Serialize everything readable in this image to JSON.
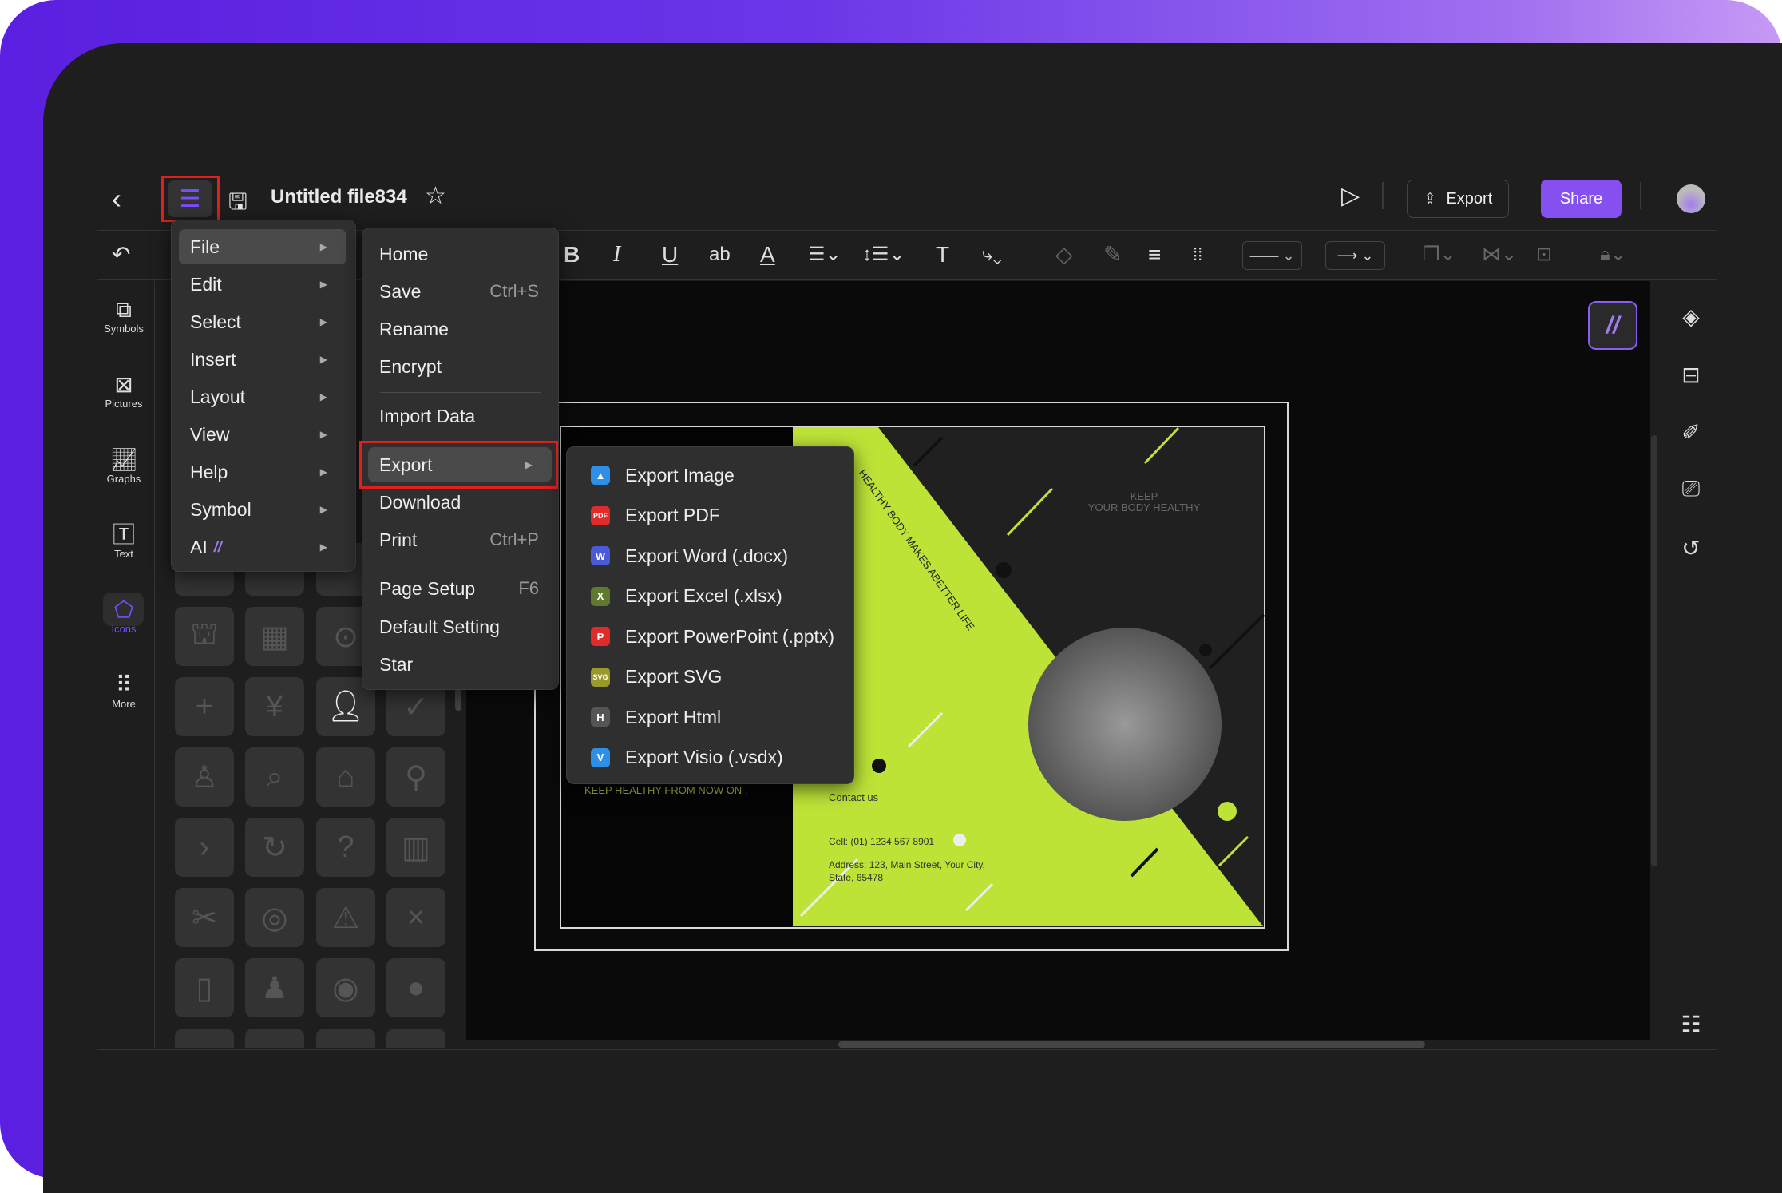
{
  "header": {
    "title": "Untitled file834",
    "export_label": "Export",
    "share_label": "Share"
  },
  "colors": {
    "accent": "#7c4dff",
    "share_bg": "#8550ef",
    "lime": "#bde337",
    "highlight_border": "#e0201c"
  },
  "sidebar": {
    "items": [
      {
        "label": "Symbols",
        "icon": "symbols-icon"
      },
      {
        "label": "Pictures",
        "icon": "pictures-icon"
      },
      {
        "label": "Graphs",
        "icon": "graphs-icon"
      },
      {
        "label": "Text",
        "icon": "text-icon"
      },
      {
        "label": "Icons",
        "icon": "icons-icon",
        "active": true
      },
      {
        "label": "More",
        "icon": "more-icon"
      }
    ]
  },
  "main_menu": {
    "items": [
      {
        "label": "File"
      },
      {
        "label": "Edit"
      },
      {
        "label": "Select"
      },
      {
        "label": "Insert"
      },
      {
        "label": "Layout"
      },
      {
        "label": "View"
      },
      {
        "label": "Help"
      },
      {
        "label": "Symbol"
      },
      {
        "label": "AI"
      }
    ]
  },
  "file_menu": {
    "items": [
      {
        "label": "Home"
      },
      {
        "label": "Save",
        "shortcut": "Ctrl+S"
      },
      {
        "label": "Rename"
      },
      {
        "label": "Encrypt"
      },
      {
        "label": "Import Data"
      },
      {
        "label": "Export"
      },
      {
        "label": "Download"
      },
      {
        "label": "Print",
        "shortcut": "Ctrl+P"
      },
      {
        "label": "Page Setup",
        "shortcut": "F6"
      },
      {
        "label": "Default Setting"
      },
      {
        "label": "Star"
      }
    ]
  },
  "export_menu": {
    "items": [
      {
        "label": "Export Image",
        "badge": "",
        "color": "#2e8fe6"
      },
      {
        "label": "Export PDF",
        "badge": "PDF",
        "color": "#e02b2b"
      },
      {
        "label": "Export Word (.docx)",
        "badge": "W",
        "color": "#4a5ad8"
      },
      {
        "label": "Export Excel (.xlsx)",
        "badge": "X",
        "color": "#5f7a2e"
      },
      {
        "label": "Export PowerPoint (.pptx)",
        "badge": "P",
        "color": "#e02b2b"
      },
      {
        "label": "Export SVG",
        "badge": "SVG",
        "color": "#9a9a2a"
      },
      {
        "label": "Export Html",
        "badge": "H",
        "color": "#555555"
      },
      {
        "label": "Export Visio (.vsdx)",
        "badge": "V",
        "color": "#2e8fe6"
      }
    ]
  },
  "document": {
    "slogan": "HEALTHY BODY MAKES ABETTER LIFE",
    "keep": "KEEP",
    "your_body": "YOUR BODY HEALTHY",
    "keep_healthy": "KEEP HEALTHY FROM NOW ON .",
    "contact": "Contact us",
    "cell": "Cell: (01) 1234 567 8901",
    "address_1": "Address: 123, Main Street, Your City,",
    "address_2": "State, 65478"
  },
  "toolbar": {
    "text_ab": "ab"
  }
}
